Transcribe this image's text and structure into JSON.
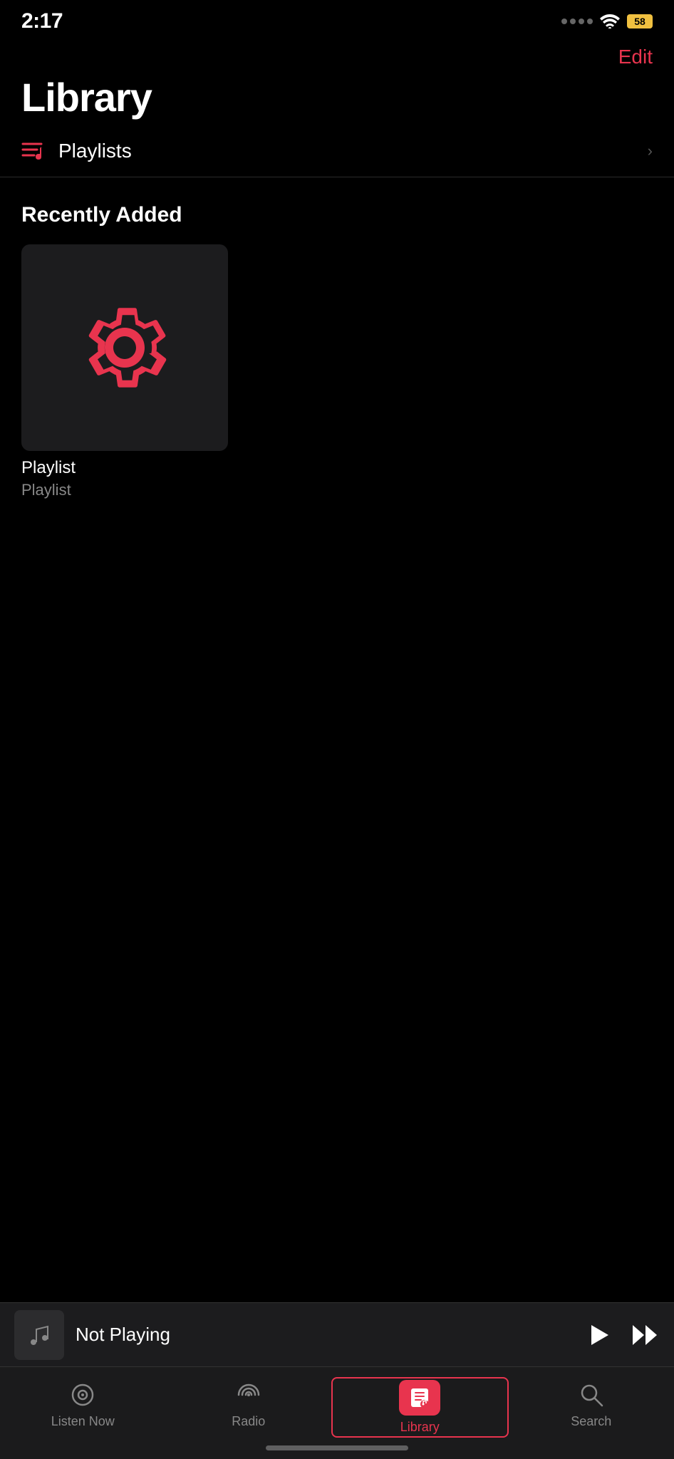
{
  "status_bar": {
    "time": "2:17",
    "battery": "58"
  },
  "header": {
    "edit_label": "Edit"
  },
  "page": {
    "title": "Library"
  },
  "playlists_row": {
    "label": "Playlists"
  },
  "recently_added": {
    "section_title": "Recently Added",
    "items": [
      {
        "title": "Playlist",
        "subtitle": "Playlist"
      }
    ]
  },
  "mini_player": {
    "title": "Not Playing"
  },
  "tab_bar": {
    "tabs": [
      {
        "id": "listen-now",
        "label": "Listen Now",
        "active": false
      },
      {
        "id": "radio",
        "label": "Radio",
        "active": false
      },
      {
        "id": "library",
        "label": "Library",
        "active": true
      },
      {
        "id": "search",
        "label": "Search",
        "active": false
      }
    ]
  }
}
